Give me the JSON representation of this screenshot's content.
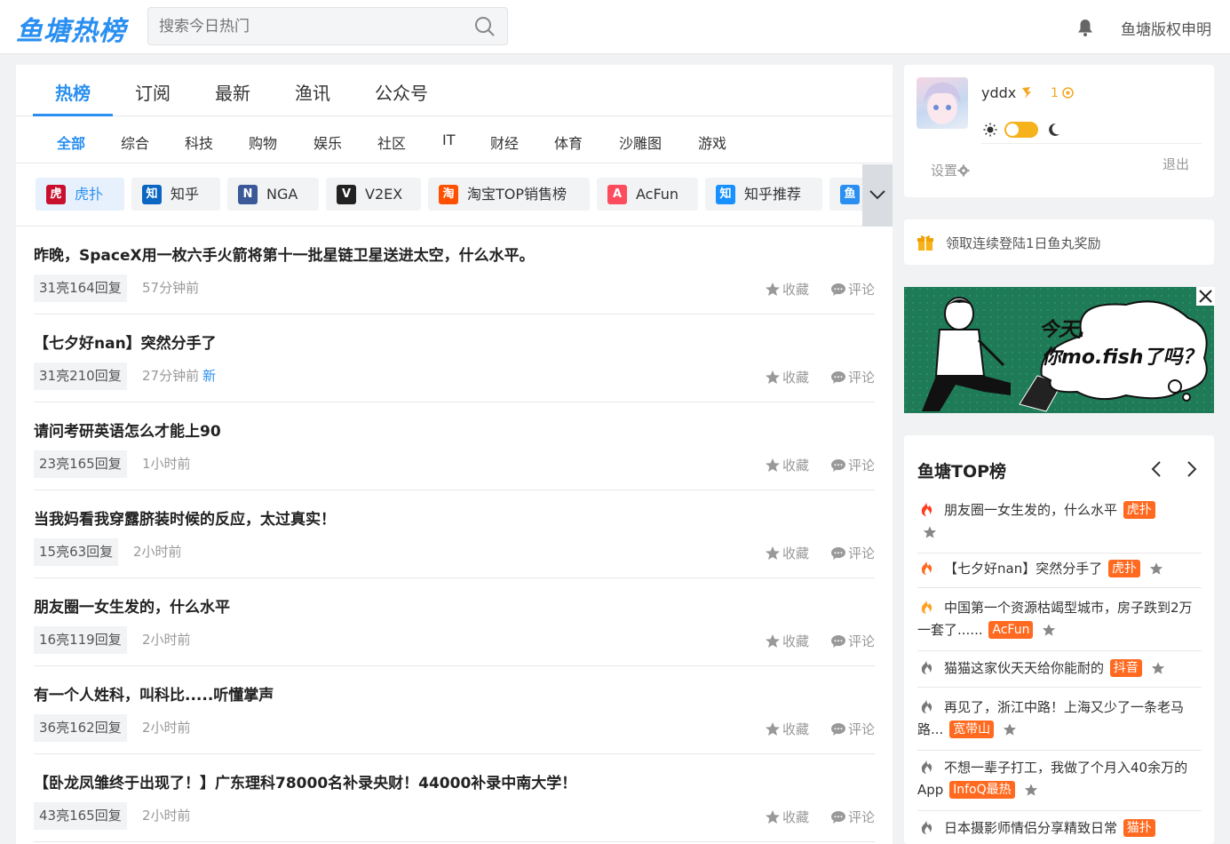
{
  "header": {
    "logo": "鱼塘热榜",
    "search_placeholder": "搜索今日热门",
    "copyright": "鱼塘版权申明"
  },
  "tabs": [
    "热榜",
    "订阅",
    "最新",
    "渔讯",
    "公众号"
  ],
  "categories": [
    "全部",
    "综合",
    "科技",
    "购物",
    "娱乐",
    "社区",
    "IT",
    "财经",
    "体育",
    "沙雕图",
    "游戏"
  ],
  "sources": [
    {
      "label": "虎扑",
      "icon": "虎",
      "color": "#c8102e"
    },
    {
      "label": "知乎",
      "icon": "知",
      "color": "#0a66c2"
    },
    {
      "label": "NGA",
      "icon": "N",
      "color": "#3b5998"
    },
    {
      "label": "V2EX",
      "icon": "V",
      "color": "#222222"
    },
    {
      "label": "淘宝TOP销售榜",
      "icon": "淘",
      "color": "#ff5000"
    },
    {
      "label": "AcFun",
      "icon": "A",
      "color": "#fd4c5d"
    },
    {
      "label": "知乎推荐",
      "icon": "知",
      "color": "#1890ff"
    },
    {
      "label": "",
      "icon": "鱼",
      "color": "#2a8ff0"
    }
  ],
  "posts": [
    {
      "title": "昨晚，SpaceX用一枚六手火箭将第十一批星链卫星送进太空，什么水平。",
      "meta": "31亮164回复",
      "time": "57分钟前",
      "new": ""
    },
    {
      "title": "【七夕好nan】突然分手了",
      "meta": "31亮210回复",
      "time": "27分钟前",
      "new": "新"
    },
    {
      "title": "请问考研英语怎么才能上90",
      "meta": "23亮165回复",
      "time": "1小时前",
      "new": ""
    },
    {
      "title": "当我妈看我穿露脐装时候的反应，太过真实！",
      "meta": "15亮63回复",
      "time": "2小时前",
      "new": ""
    },
    {
      "title": "朋友圈一女生发的，什么水平",
      "meta": "16亮119回复",
      "time": "2小时前",
      "new": ""
    },
    {
      "title": "有一个人姓科，叫科比.....听懂掌声",
      "meta": "36亮162回复",
      "time": "2小时前",
      "new": ""
    },
    {
      "title": "【卧龙凤雏终于出现了！】广东理科78000名补录央财！44000补录中南大学！",
      "meta": "43亮165回复",
      "time": "2小时前",
      "new": ""
    }
  ],
  "actions": {
    "fav": "收藏",
    "comment": "评论"
  },
  "user": {
    "name": "yddx",
    "level": "1",
    "settings": "设置",
    "logout": "退出"
  },
  "reward_text": "领取连续登陆1日鱼丸奖励",
  "banner": {
    "line1": "今天,",
    "line2": "你mo.fish了吗？"
  },
  "top_list": {
    "title": "鱼塘TOP榜",
    "items": [
      {
        "text": "朋友圈一女生发的，什么水平",
        "tag": "虎扑",
        "color": "#ff3b1f"
      },
      {
        "text": "【七夕好nan】突然分手了",
        "tag": "虎扑",
        "color": "#ff6a20"
      },
      {
        "text": "中国第一个资源枯竭型城市，房子跌到2万一套了......",
        "tag": "AcFun",
        "color": "#ffa020"
      },
      {
        "text": "猫猫这家伙天天给你能耐的",
        "tag": "抖音",
        "color": "#777777"
      },
      {
        "text": "再见了，浙江中路！上海又少了一条老马路...",
        "tag": "宽带山",
        "color": "#777777"
      },
      {
        "text": "不想一辈子打工，我做了个月入40余万的App",
        "tag": "InfoQ最热",
        "color": "#777777"
      },
      {
        "text": "日本摄影师情侣分享精致日常",
        "tag": "猫扑",
        "color": "#777777"
      }
    ]
  }
}
